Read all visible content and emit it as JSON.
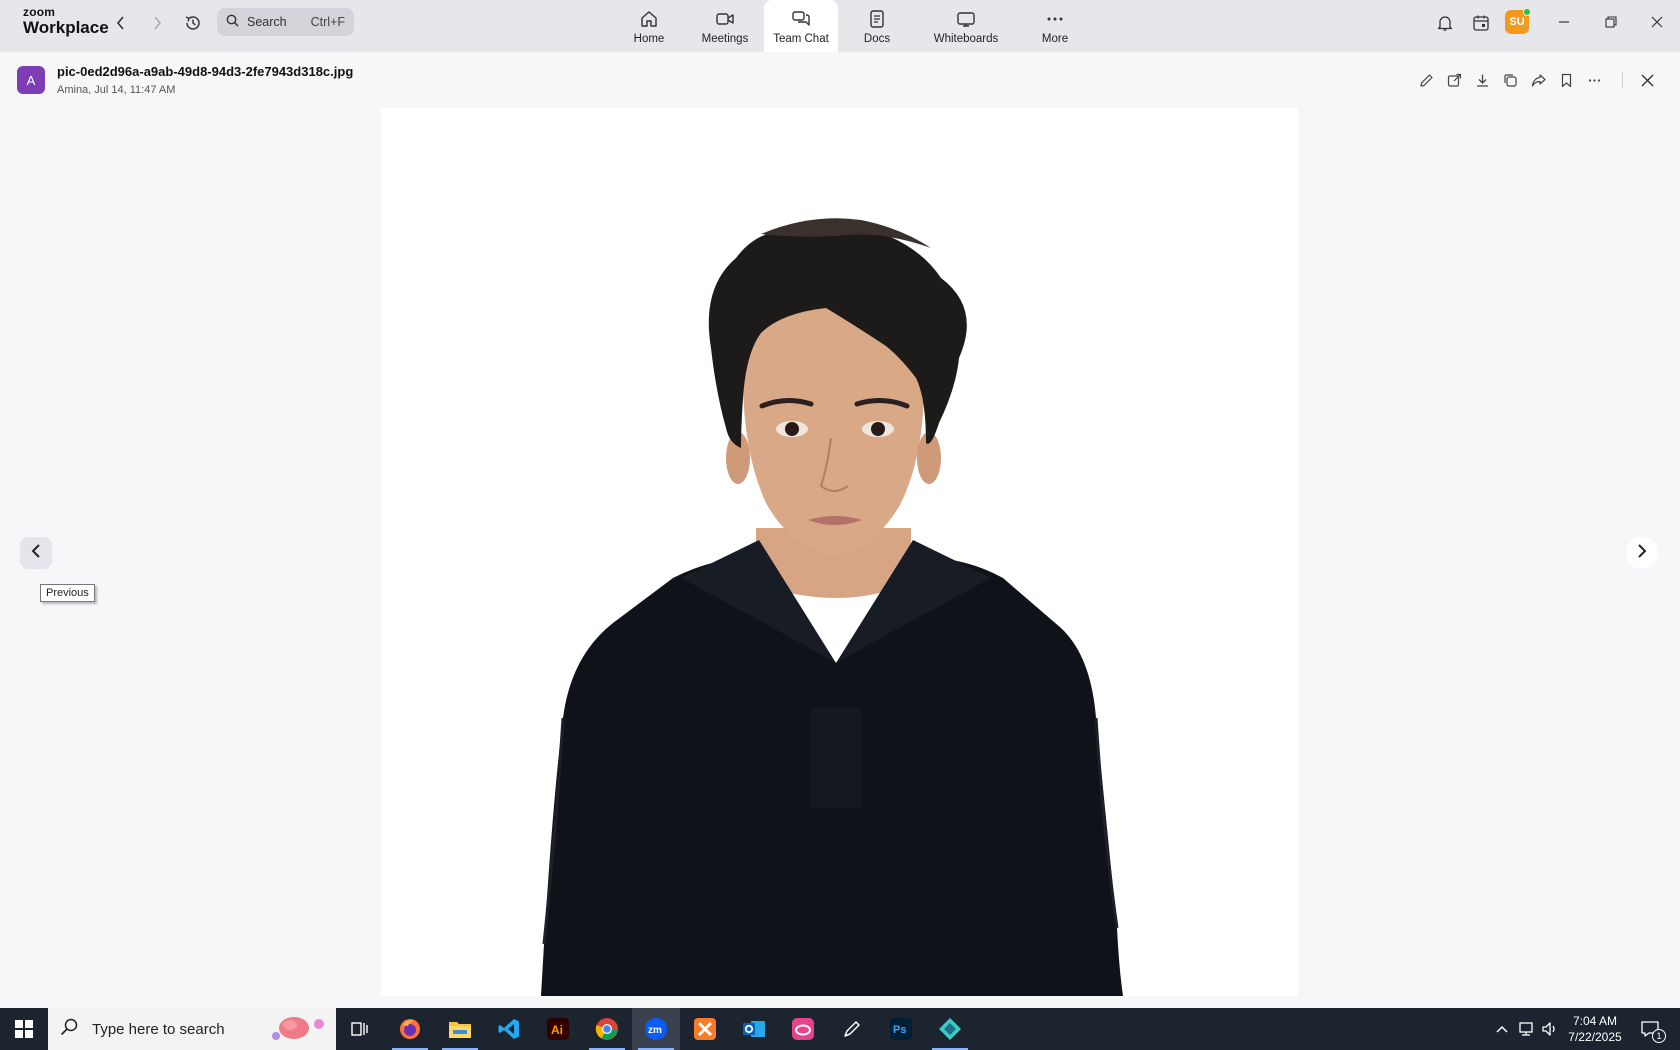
{
  "app": {
    "brand_top": "zoom",
    "brand_bottom": "Workplace"
  },
  "search": {
    "label": "Search",
    "shortcut": "Ctrl+F"
  },
  "tabs": [
    {
      "label": "Home",
      "icon": "home-icon"
    },
    {
      "label": "Meetings",
      "icon": "video-icon"
    },
    {
      "label": "Team Chat",
      "icon": "chat-icon",
      "active": true
    },
    {
      "label": "Docs",
      "icon": "doc-icon"
    },
    {
      "label": "Whiteboards",
      "icon": "whiteboard-icon"
    },
    {
      "label": "More",
      "icon": "more-icon"
    }
  ],
  "user": {
    "initials": "SU",
    "status": "online"
  },
  "file": {
    "avatar_initial": "A",
    "name": "pic-0ed2d96a-a9ab-49d8-94d3-2fe7943d318c.jpg",
    "meta": "Amina, Jul 14, 11:47 AM"
  },
  "viewer": {
    "prev_tooltip": "Previous"
  },
  "taskbar": {
    "search_placeholder": "Type here to search",
    "time": "7:04 AM",
    "date": "7/22/2025",
    "notification_count": "1",
    "apps": [
      "Firefox",
      "File Explorer",
      "VS Code",
      "Illustrator",
      "Chrome",
      "Zoom",
      "XAMPP",
      "Outlook",
      "Creative Cloud",
      "Pen tool",
      "Photoshop",
      "App"
    ]
  },
  "colors": {
    "topbar_bg": "#e6e7eb",
    "viewer_bg": "#f7f7fa",
    "file_avatar": "#7f3db5",
    "user_avatar": "#f29a1f",
    "online": "#2bc24b",
    "taskbar": "#1c2430"
  }
}
